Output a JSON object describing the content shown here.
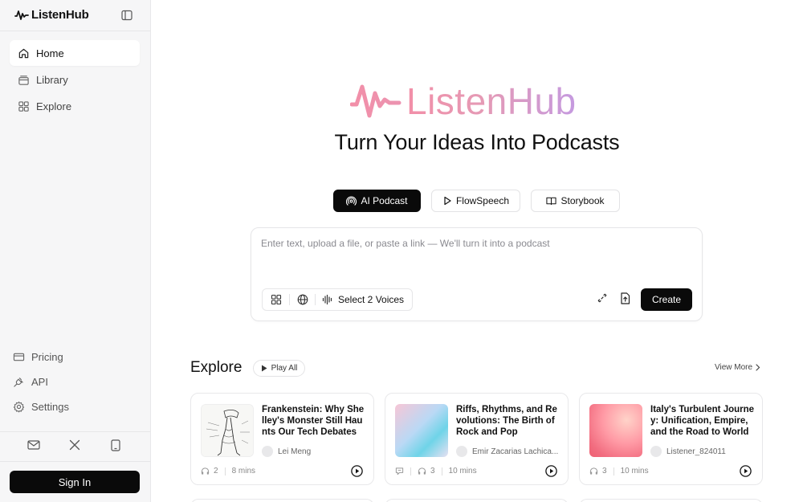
{
  "app": {
    "brand": "ListenHub"
  },
  "sidebar": {
    "items": [
      {
        "label": "Home",
        "icon": "home-icon",
        "active": true
      },
      {
        "label": "Library",
        "icon": "library-icon"
      },
      {
        "label": "Explore",
        "icon": "grid-icon"
      }
    ],
    "bottom": [
      {
        "label": "Pricing",
        "icon": "card-icon"
      },
      {
        "label": "API",
        "icon": "plug-icon"
      },
      {
        "label": "Settings",
        "icon": "gear-icon"
      }
    ],
    "signin_label": "Sign In"
  },
  "hero": {
    "logo_text": "ListenHub",
    "title": "Turn Your Ideas Into Podcasts"
  },
  "modes": [
    {
      "label": "AI Podcast",
      "active": true
    },
    {
      "label": "FlowSpeech"
    },
    {
      "label": "Storybook"
    }
  ],
  "composer": {
    "placeholder": "Enter text, upload a file, or paste a link — We'll turn it into a podcast",
    "voices_label": "Select 2 Voices",
    "create_label": "Create"
  },
  "explore": {
    "title": "Explore",
    "play_all": "Play All",
    "view_more": "View More",
    "cards": [
      {
        "title": "Frankenstein: Why Shelley's Monster Still Haunts Our Tech Debates",
        "author": "Lei Meng",
        "listens": "2",
        "duration": "8 mins"
      },
      {
        "title": "Riffs, Rhythms, and Revolutions: The Birth of Rock and Pop",
        "author": "Emir Zacarias Lachica...",
        "listens": "3",
        "duration": "10 mins"
      },
      {
        "title": "Italy's Turbulent Journey: Unification, Empire, and the Road to World ...",
        "author": "Listener_824011",
        "listens": "3",
        "duration": "10 mins"
      }
    ]
  },
  "colors": {
    "accent_dark": "#0a0a0a",
    "brand_gradient_start": "#f28fa8",
    "brand_gradient_end": "#c59ae0"
  }
}
